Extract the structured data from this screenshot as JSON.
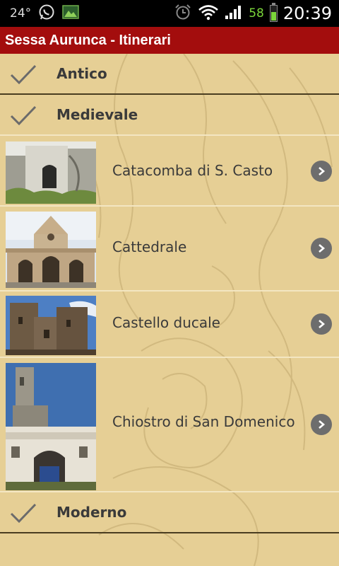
{
  "status_bar": {
    "temperature": "24°",
    "battery_level": "58",
    "time": "20:39"
  },
  "app": {
    "title": "Sessa Aurunca - Itinerari"
  },
  "sections": [
    {
      "label": "Antico"
    },
    {
      "label": "Medievale"
    },
    {
      "label": "Moderno"
    }
  ],
  "items": [
    {
      "label": "Catacomba di S. Casto"
    },
    {
      "label": "Cattedrale"
    },
    {
      "label": "Castello ducale"
    },
    {
      "label": "Chiostro di San Domenico"
    }
  ]
}
